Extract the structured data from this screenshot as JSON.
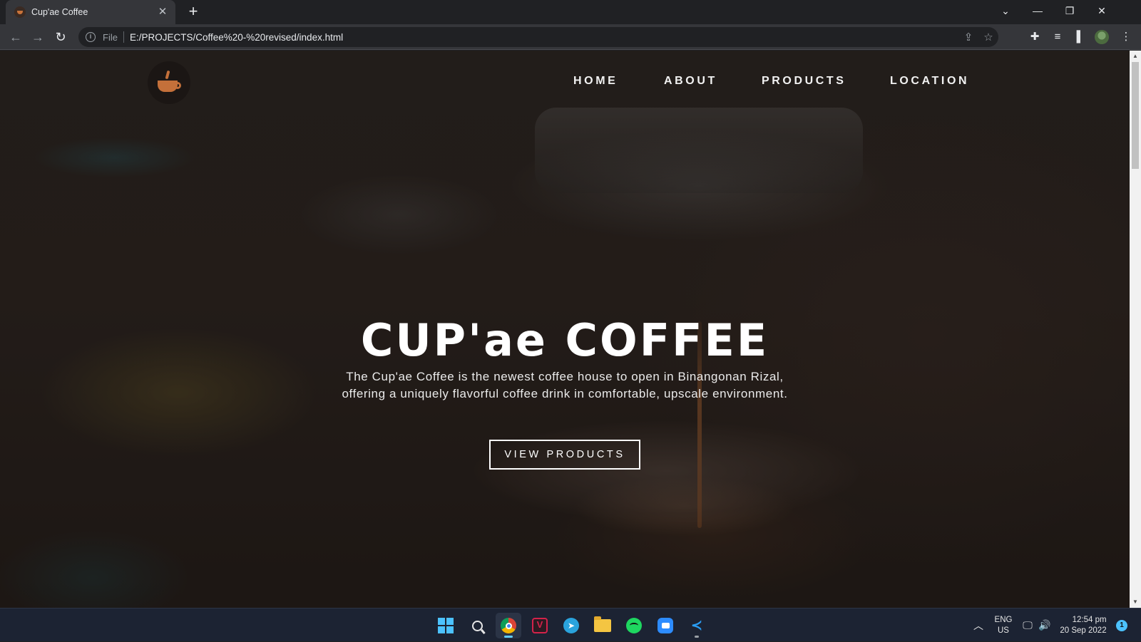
{
  "browser": {
    "tab_title": "Cup'ae Coffee",
    "scheme_label": "File",
    "url": "E:/PROJECTS/Coffee%20-%20revised/index.html"
  },
  "site": {
    "nav": [
      "HOME",
      "ABOUT",
      "PRODUCTS",
      "LOCATION"
    ],
    "hero_title": "CUP'ae COFFEE",
    "hero_description": "The Cup'ae Coffee is the newest coffee house to open in Binangonan Rizal, offering a uniquely flavorful coffee drink in comfortable, upscale environment.",
    "cta_label": "VIEW PRODUCTS"
  },
  "taskbar": {
    "apps": [
      "windows-start",
      "search",
      "chrome",
      "vivaldi",
      "telegram",
      "file-explorer",
      "spotify",
      "zoom",
      "vscode"
    ],
    "language_line1": "ENG",
    "language_line2": "US",
    "time": "12:54 pm",
    "date": "20 Sep 2022",
    "notification_count": "1"
  },
  "colors": {
    "accent": "#c4703a",
    "chrome_dark": "#202124",
    "taskbar": "#1c2333"
  }
}
